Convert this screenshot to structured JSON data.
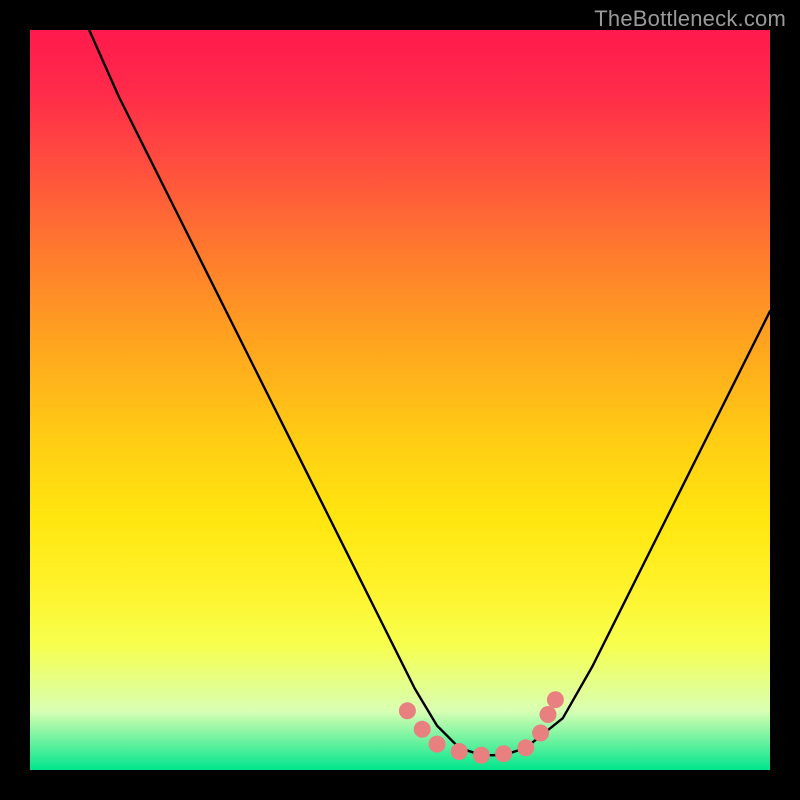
{
  "watermark": "TheBottleneck.com",
  "chart_data": {
    "type": "line",
    "title": "",
    "xlabel": "",
    "ylabel": "",
    "xlim": [
      0,
      100
    ],
    "ylim": [
      0,
      100
    ],
    "series": [
      {
        "name": "bottleneck-curve",
        "x": [
          8,
          12,
          16,
          20,
          24,
          28,
          32,
          36,
          40,
          44,
          48,
          52,
          55,
          58,
          61,
          64,
          67,
          72,
          76,
          80,
          84,
          88,
          92,
          96,
          100
        ],
        "y": [
          100,
          91,
          83,
          75,
          67,
          59,
          51,
          43,
          35,
          27,
          19,
          11,
          6,
          3,
          2,
          2,
          3,
          7,
          14,
          22,
          30,
          38,
          46,
          54,
          62
        ],
        "color": "#000000"
      },
      {
        "name": "highlight-dots",
        "x": [
          51,
          53,
          55,
          58,
          61,
          64,
          67,
          69,
          70,
          71
        ],
        "y": [
          8,
          5.5,
          3.5,
          2.5,
          2,
          2.2,
          3,
          5,
          7.5,
          9.5
        ],
        "color": "#e88080"
      }
    ],
    "background_gradient": {
      "top": "#ff1a4d",
      "mid": "#ffe60f",
      "bottom": "#00e58c"
    }
  }
}
